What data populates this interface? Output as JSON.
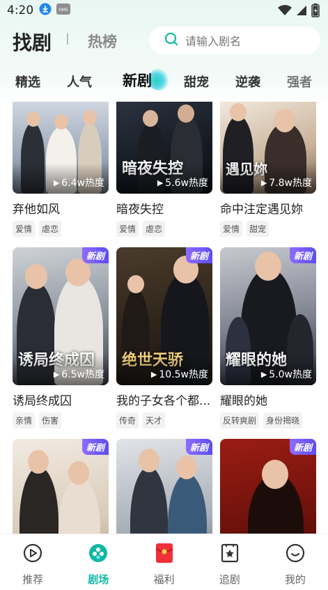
{
  "status_bar": {
    "time": "4:20"
  },
  "header": {
    "title": "找剧",
    "hot_tab": "热榜",
    "search_placeholder": "请输入剧名"
  },
  "tabs": [
    {
      "label": "精选"
    },
    {
      "label": "人气"
    },
    {
      "label": "新剧"
    },
    {
      "label": "甜宠"
    },
    {
      "label": "逆袭"
    },
    {
      "label": "强者"
    }
  ],
  "dramas": [
    {
      "title": "弃他如风",
      "views": "6.4w热度",
      "tags": [
        "爱情",
        "虐恋"
      ],
      "badge": "",
      "poster_text": ""
    },
    {
      "title": "暗夜失控",
      "views": "5.6w热度",
      "tags": [
        "爱情",
        "虐恋"
      ],
      "badge": "",
      "poster_text": "暗夜失控"
    },
    {
      "title": "命中注定遇见妳",
      "views": "7.8w热度",
      "tags": [
        "爱情",
        "甜宠"
      ],
      "badge": "",
      "poster_text": "遇见妳"
    },
    {
      "title": "诱局终成囚",
      "views": "6.5w热度",
      "tags": [
        "亲情",
        "伤害"
      ],
      "badge": "新剧",
      "poster_text": "诱局终成囚"
    },
    {
      "title": "我的子女各个都...",
      "views": "10.5w热度",
      "tags": [
        "传奇",
        "天才"
      ],
      "badge": "新剧",
      "poster_text": "绝世天骄"
    },
    {
      "title": "耀眼的她",
      "views": "5.0w热度",
      "tags": [
        "反转爽剧",
        "身份揭晓"
      ],
      "badge": "新剧",
      "poster_text": "耀眼的她"
    },
    {
      "title": "",
      "views": "",
      "tags": [],
      "badge": "新剧",
      "poster_text": ""
    },
    {
      "title": "",
      "views": "",
      "tags": [],
      "badge": "新剧",
      "poster_text": ""
    },
    {
      "title": "",
      "views": "",
      "tags": [],
      "badge": "新剧",
      "poster_text": ""
    }
  ],
  "bottom_nav": [
    {
      "label": "推荐",
      "icon": "play-circle-icon"
    },
    {
      "label": "剧场",
      "icon": "theater-icon"
    },
    {
      "label": "福利",
      "icon": "red-envelope-icon"
    },
    {
      "label": "追剧",
      "icon": "bookmark-star-icon"
    },
    {
      "label": "我的",
      "icon": "smile-icon"
    }
  ],
  "colors": {
    "accent": "#12b8a6",
    "badge": "#6a55f5"
  }
}
